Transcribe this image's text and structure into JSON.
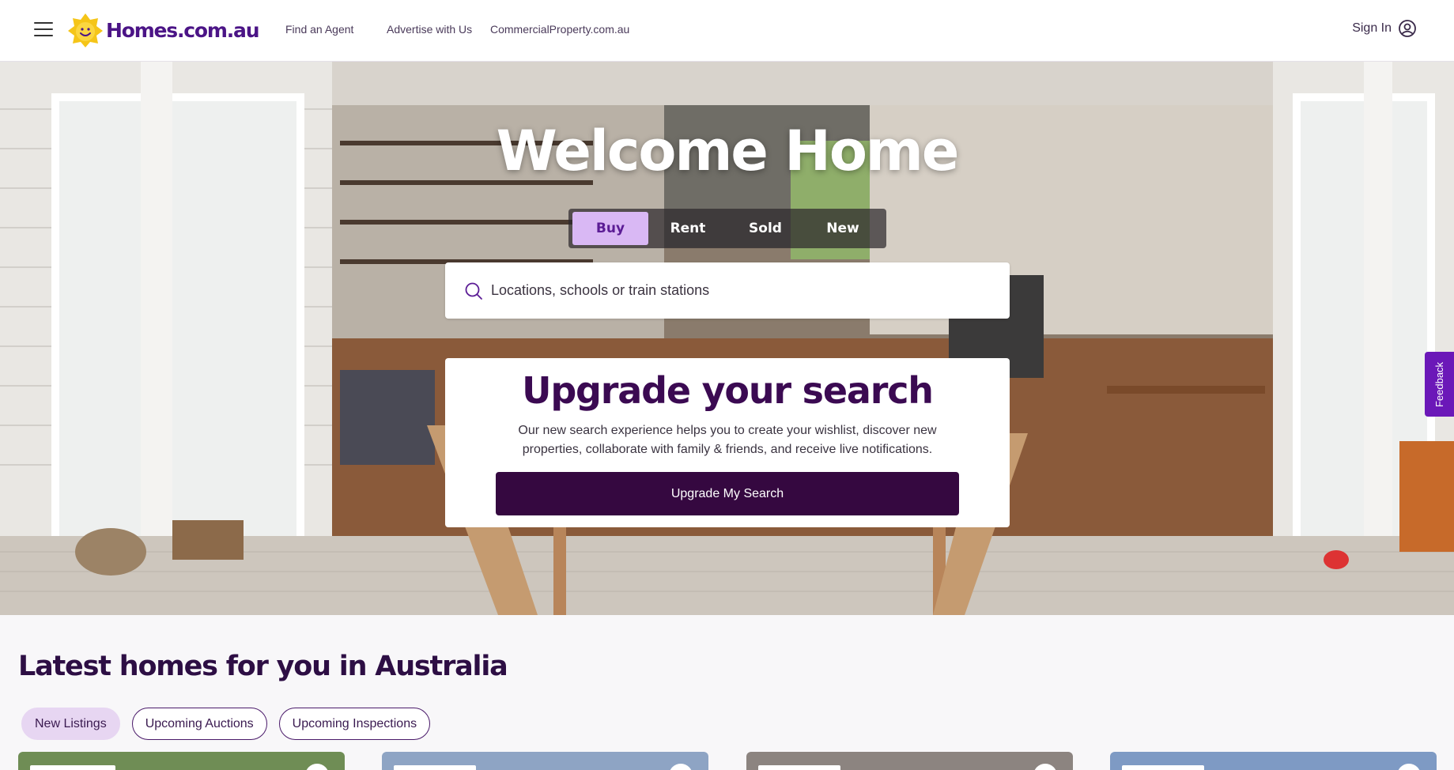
{
  "header": {
    "logo_text": "Homes.com.au",
    "nav": [
      "Find an Agent",
      "Advertise with Us",
      "CommercialProperty.com.au"
    ],
    "sign_in": "Sign In"
  },
  "hero": {
    "title": "Welcome Home",
    "tabs": [
      {
        "label": "Buy",
        "active": true
      },
      {
        "label": "Rent",
        "active": false
      },
      {
        "label": "Sold",
        "active": false
      },
      {
        "label": "New",
        "active": false
      }
    ],
    "search": {
      "placeholder": "Locations, schools or train stations",
      "value": ""
    },
    "upgrade": {
      "title": "Upgrade your search",
      "description": "Our new search experience helps you to create your wishlist, discover new properties, collaborate with family & friends, and receive live notifications.",
      "button": "Upgrade My Search"
    }
  },
  "feedback": {
    "label": "Feedback"
  },
  "latest": {
    "title": "Latest homes for you in Australia",
    "filters": [
      {
        "label": "New Listings",
        "active": true
      },
      {
        "label": "Upcoming Auctions",
        "active": false
      },
      {
        "label": "Upcoming Inspections",
        "active": false
      }
    ]
  },
  "colors": {
    "brand_purple": "#4b1486",
    "accent_lilac": "#d9b8f4",
    "dark_plum": "#350840",
    "feedback_tab": "#6b18b8",
    "logo_yellow": "#f5c518"
  }
}
